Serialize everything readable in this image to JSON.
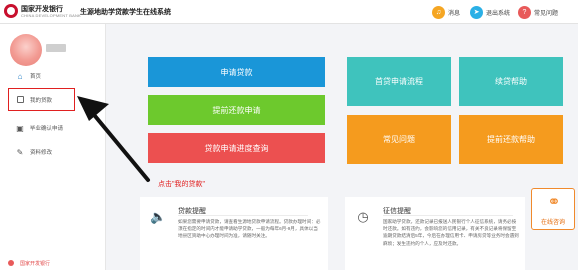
{
  "header": {
    "bank_name": "国家开发银行",
    "bank_sub": "CHINA DEVELOPMENT BANK",
    "system_title": "生源地助学贷款学生在线系统",
    "message_label": "消息",
    "exit_label": "退出系统",
    "faq_label": "常见问题",
    "icons": [
      "bell-icon",
      "exit-icon",
      "question-icon"
    ]
  },
  "sidebar": {
    "items": [
      {
        "label": "首页",
        "icon": "home-icon"
      },
      {
        "label": "我的贷款",
        "icon": "calendar-icon"
      },
      {
        "label": "毕业确认申请",
        "icon": "monitor-icon"
      },
      {
        "label": "资料修改",
        "icon": "edit-icon"
      }
    ],
    "footer": "国家开发银行"
  },
  "tiles": {
    "apply": "申请贷款",
    "submit_repay": "提前还款申请",
    "progress": "贷款申请进度查询",
    "first_flow": "首贷申请流程",
    "renew_help": "续贷帮助",
    "faq": "常见问题",
    "repay_help": "提前还款帮助"
  },
  "cards": {
    "loan": {
      "title": "贷款提醒",
      "icon": "speaker-icon",
      "text": "如果您需要申请贷款，请查看生源地贷款申请流程。贷款办理时间：必须在指定的时间内才能申请助学贷款，一般为每年6月-9月，具体以当地县区资助中心办理时间为准，请随时关注。"
    },
    "credit": {
      "title": "征信提醒",
      "icon": "clock-icon",
      "text": "国家助学贷款，还款记录已报送人民银行个人征信系统，请务必按时还款。如有违约，会影响您的信用记录，有关不良记录将保留至逾期贷款结清后5年，今后在办理信用卡、申请房贷等业务时会遇到麻烦；发生违约的个人，应及时还款。"
    }
  },
  "annotation": {
    "text": "点击\"我的贷款\""
  },
  "consult": {
    "label": "在线咨询",
    "icon": "headset-icon"
  },
  "colors": {
    "blue": "#1a96d8",
    "green": "#6dc92d",
    "red": "#ec5050",
    "teal": "#3fc3bd",
    "orange": "#f59b1e",
    "annotation_red": "#e02020"
  }
}
